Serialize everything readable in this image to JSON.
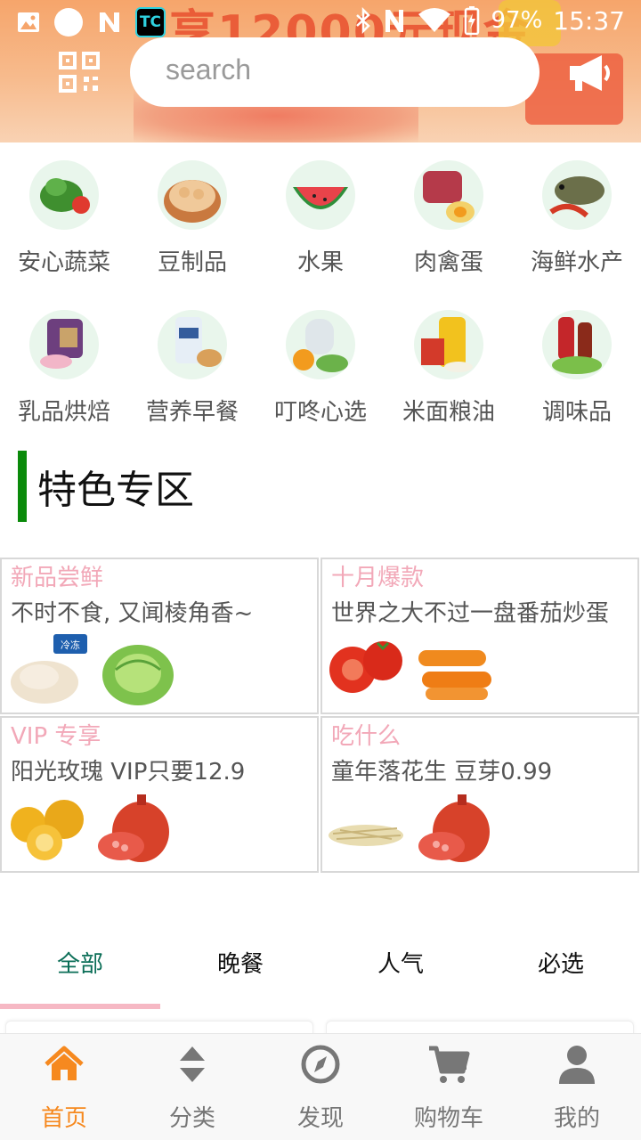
{
  "status_bar": {
    "app_badge": "TC",
    "battery": "97%",
    "time": "15:37"
  },
  "header": {
    "search_placeholder": "search",
    "banner_promo_text": "享12000元现金"
  },
  "categories": [
    {
      "label": "安心蔬菜",
      "icon": "vegetables"
    },
    {
      "label": "豆制品",
      "icon": "soy-products"
    },
    {
      "label": "水果",
      "icon": "fruit"
    },
    {
      "label": "肉禽蛋",
      "icon": "meat-eggs"
    },
    {
      "label": "海鲜水产",
      "icon": "seafood"
    },
    {
      "label": "乳品烘焙",
      "icon": "dairy-bakery"
    },
    {
      "label": "营养早餐",
      "icon": "breakfast"
    },
    {
      "label": "叮咚心选",
      "icon": "dingdong-select"
    },
    {
      "label": "米面粮油",
      "icon": "grain-oil"
    },
    {
      "label": "调味品",
      "icon": "condiments"
    }
  ],
  "special_zone": {
    "title": "特色专区",
    "cards": [
      {
        "tag": "新品尝鲜",
        "desc": "不时不食, 又闻棱角香~",
        "images": [
          "chicken",
          "lettuce"
        ],
        "badge": "冷冻"
      },
      {
        "tag": "十月爆款",
        "desc": "世界之大不过一盘番茄炒蛋",
        "images": [
          "tomato",
          "carrot"
        ]
      },
      {
        "tag": "VIP 专享",
        "desc": "阳光玫瑰 VIP只要12.9",
        "images": [
          "orange",
          "pomegranate"
        ]
      },
      {
        "tag": "吃什么",
        "desc": "童年落花生 豆芽0.99",
        "images": [
          "bean-sprouts",
          "pomegranate"
        ]
      }
    ]
  },
  "tabs": [
    {
      "label": "全部",
      "active": true
    },
    {
      "label": "晚餐",
      "active": false
    },
    {
      "label": "人气",
      "active": false
    },
    {
      "label": "必选",
      "active": false
    }
  ],
  "bottom_nav": [
    {
      "label": "首页",
      "icon": "home-icon",
      "active": true
    },
    {
      "label": "分类",
      "icon": "sort-icon",
      "active": false
    },
    {
      "label": "发现",
      "icon": "compass-icon",
      "active": false
    },
    {
      "label": "购物车",
      "icon": "cart-icon",
      "active": false
    },
    {
      "label": "我的",
      "icon": "user-icon",
      "active": false
    }
  ],
  "colors": {
    "accent_orange": "#f6891f",
    "zone_bar_green": "#0a8a0a",
    "active_tab": "#0b6e57",
    "tag_pink": "#f2a8b8"
  }
}
